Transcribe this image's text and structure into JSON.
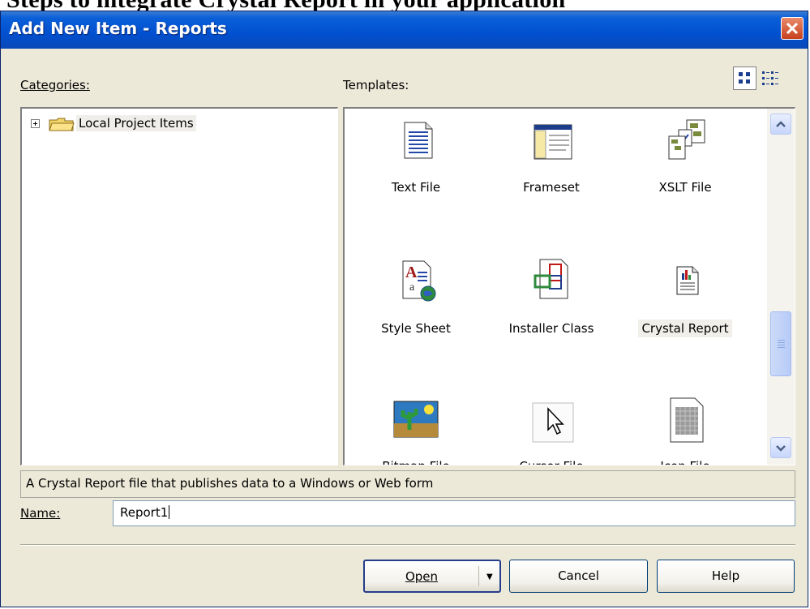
{
  "top_text": "Steps to integrate Crystal Report in your application",
  "window": {
    "title": "Add New Item - Reports"
  },
  "categories": {
    "label": "Categories:",
    "items": [
      {
        "label": "Local Project Items",
        "icon": "folder-icon"
      }
    ]
  },
  "templates": {
    "label": "Templates:",
    "view_modes": [
      "large-icons",
      "small-icons"
    ],
    "items": [
      {
        "label": "Text File",
        "icon": "text-file-icon"
      },
      {
        "label": "Frameset",
        "icon": "frameset-icon"
      },
      {
        "label": "XSLT File",
        "icon": "xslt-file-icon"
      },
      {
        "label": "Style Sheet",
        "icon": "style-sheet-icon"
      },
      {
        "label": "Installer Class",
        "icon": "installer-class-icon"
      },
      {
        "label": "Crystal Report",
        "icon": "crystal-report-icon",
        "selected": true
      },
      {
        "label": "Bitmap File",
        "icon": "bitmap-file-icon"
      },
      {
        "label": "Cursor File",
        "icon": "cursor-file-icon"
      },
      {
        "label": "Icon File",
        "icon": "icon-file-icon"
      }
    ]
  },
  "description": "A Crystal Report file that publishes data to a Windows or Web form",
  "name_field": {
    "label": "Name:",
    "value": "Report1"
  },
  "buttons": {
    "open": "Open",
    "cancel": "Cancel",
    "help": "Help"
  },
  "colors": {
    "titlebar": "#0150d0",
    "dialog_bg": "#ece9d8",
    "close_button": "#d4542f"
  }
}
